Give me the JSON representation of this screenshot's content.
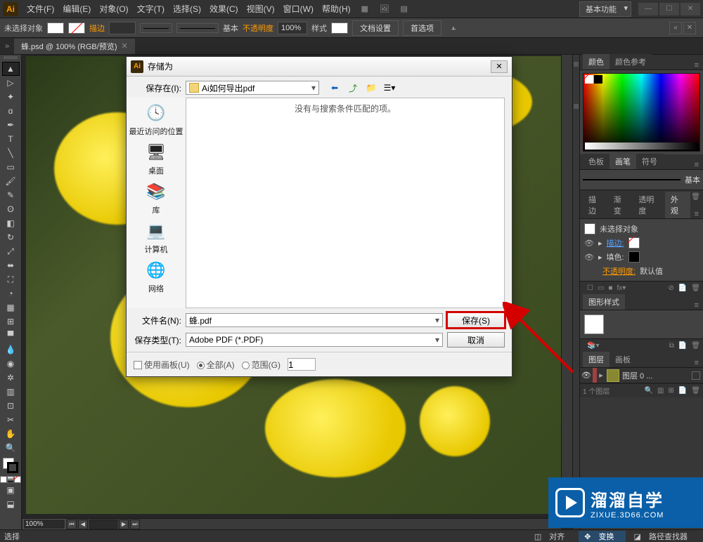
{
  "menu": {
    "items": [
      "文件(F)",
      "编辑(E)",
      "对象(O)",
      "文字(T)",
      "选择(S)",
      "效果(C)",
      "视图(V)",
      "窗口(W)",
      "帮助(H)"
    ],
    "workspace": "基本功能"
  },
  "control_bar": {
    "no_selection": "未选择对象",
    "stroke_label": "描边",
    "stroke_pt": "",
    "style_basic": "基本",
    "opacity_label": "不透明度",
    "opacity_value": "100%",
    "style_label": "样式",
    "doc_setup": "文档设置",
    "prefs": "首选项"
  },
  "document": {
    "tab": "蜂.psd @ 100% (RGB/预览)",
    "zoom": "100%",
    "status": "选择"
  },
  "dialog": {
    "title": "存储为",
    "save_in_label": "保存在(I):",
    "save_in_value": "Ai如何导出pdf",
    "places": {
      "recent": "最近访问的位置",
      "desktop": "桌面",
      "library": "库",
      "computer": "计算机",
      "network": "网络"
    },
    "empty_msg": "没有与搜索条件匹配的项。",
    "filename_label": "文件名(N):",
    "filename_value": "蜂.pdf",
    "filetype_label": "保存类型(T):",
    "filetype_value": "Adobe PDF (*.PDF)",
    "save_btn": "保存(S)",
    "cancel_btn": "取消",
    "use_artboards": "使用画板(U)",
    "all": "全部(A)",
    "range": "范围(G)",
    "range_value": "1"
  },
  "panels": {
    "color_tab": "颜色",
    "color_guide_tab": "颜色参考",
    "swatch_tab": "色板",
    "brush_tab": "画笔",
    "symbol_tab": "符号",
    "brush_name": "基本",
    "stroke_tab": "描边",
    "grad_tab": "渐变",
    "transp_tab": "透明度",
    "appear_tab": "外观",
    "appear_title": "未选择对象",
    "appear_stroke": "描边:",
    "appear_fill": "填色:",
    "appear_opacity": "不透明度:",
    "appear_default": "默认值",
    "gs_tab": "图形样式",
    "layers_tab": "图层",
    "artboards_tab": "画板",
    "layer_name": "图层 0",
    "layer_count": "1 个图层"
  },
  "status": {
    "transform": "变换",
    "pathfinder": "路径查找器",
    "align": "对齐"
  },
  "watermark": {
    "big": "溜溜自学",
    "small": "ZIXUE.3D66.COM"
  }
}
